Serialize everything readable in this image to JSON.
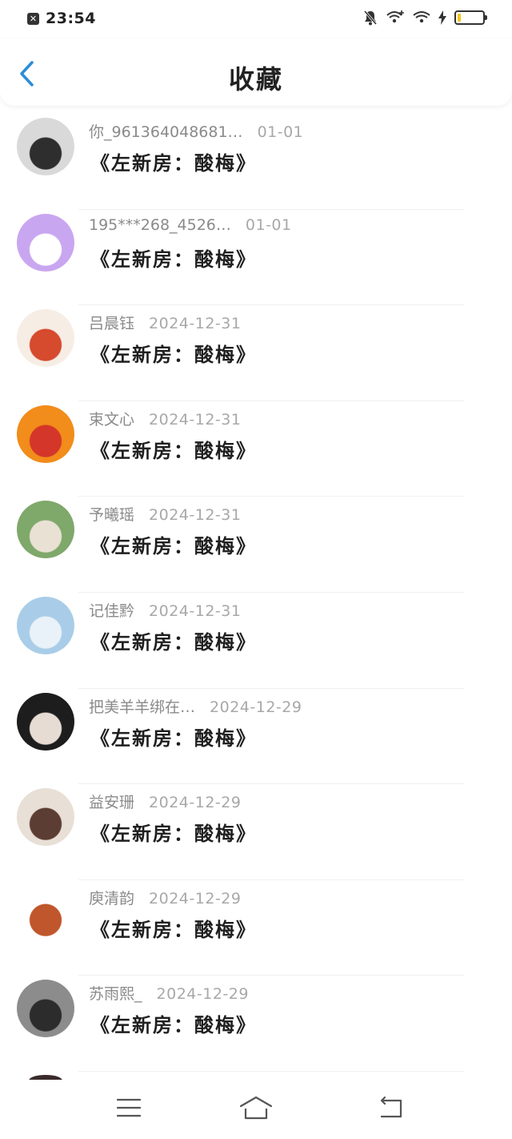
{
  "status_bar": {
    "time": "23:54",
    "battery_level": 0.12,
    "battery_color": "#f5c518",
    "icons": [
      "close-box-icon",
      "bell-muted-icon",
      "wifi-plus-icon",
      "wifi-icon",
      "charging-icon",
      "battery-icon"
    ]
  },
  "header": {
    "title": "收藏",
    "back_icon": "chevron-left-icon",
    "accent_color": "#2a8cd8"
  },
  "favorites": [
    {
      "name": "你_961364048681…",
      "date": "01-01",
      "title": "《左新房：酸梅》",
      "avatar_colors": [
        "#d9d9d9",
        "#2e2e2e"
      ]
    },
    {
      "name": "195***268_4526…",
      "date": "01-01",
      "title": "《左新房：酸梅》",
      "avatar_colors": [
        "#c9a6f0",
        "#ffffff"
      ]
    },
    {
      "name": "吕晨钰",
      "date": "2024-12-31",
      "title": "《左新房：酸梅》",
      "avatar_colors": [
        "#f6ede5",
        "#d64a2e"
      ]
    },
    {
      "name": "束文心",
      "date": "2024-12-31",
      "title": "《左新房：酸梅》",
      "avatar_colors": [
        "#f28c1a",
        "#d4362a"
      ]
    },
    {
      "name": "予曦瑶",
      "date": "2024-12-31",
      "title": "《左新房：酸梅》",
      "avatar_colors": [
        "#7fa86b",
        "#e9e1d4"
      ]
    },
    {
      "name": "记佳黔",
      "date": "2024-12-31",
      "title": "《左新房：酸梅》",
      "avatar_colors": [
        "#a9cde8",
        "#e9f2f8"
      ]
    },
    {
      "name": "把美羊羊绑在…",
      "date": "2024-12-29",
      "title": "《左新房：酸梅》",
      "avatar_colors": [
        "#1d1d1d",
        "#e6dcd3"
      ]
    },
    {
      "name": "益安珊",
      "date": "2024-12-29",
      "title": "《左新房：酸梅》",
      "avatar_colors": [
        "#e8dfd6",
        "#5b3d33"
      ]
    },
    {
      "name": "庾清韵",
      "date": "2024-12-29",
      "title": "《左新房：酸梅》",
      "avatar_colors": [
        "#ffffff",
        "#c0562b"
      ]
    },
    {
      "name": "苏雨熙_",
      "date": "2024-12-29",
      "title": "《左新房：酸梅》",
      "avatar_colors": [
        "#8c8c8c",
        "#2c2c2c"
      ]
    }
  ],
  "nav_bar": {
    "icons": [
      "menu-icon",
      "home-icon",
      "back-icon"
    ]
  }
}
